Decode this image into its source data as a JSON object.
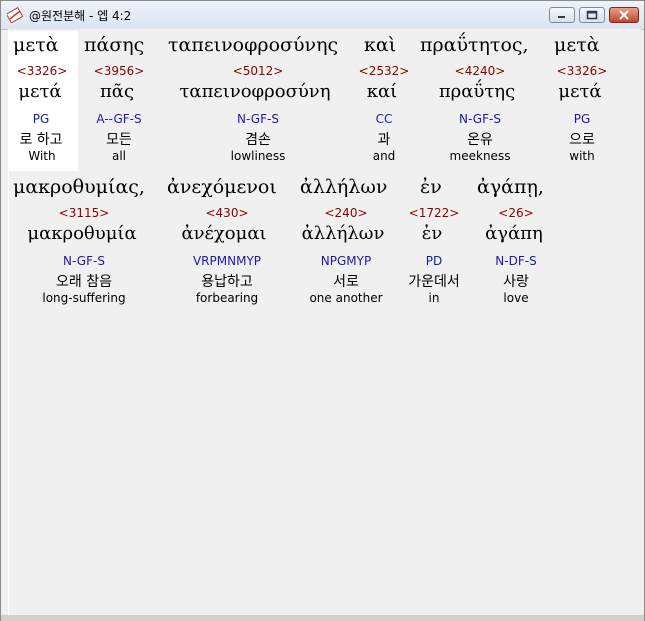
{
  "window": {
    "title": "@원전분해 - 엡 4:2",
    "minimize_icon": "minimize-icon",
    "maximize_icon": "maximize-icon",
    "close_icon": "close-icon"
  },
  "words": [
    {
      "greek": "μετὰ",
      "strong": "<3326>",
      "lemma": "μετά",
      "parse": "PG",
      "korean": "로 하고",
      "english": "With",
      "selected": true
    },
    {
      "greek": "πάσης",
      "strong": "<3956>",
      "lemma": "πᾶς",
      "parse": "A--GF-S",
      "korean": "모든",
      "english": "all"
    },
    {
      "greek": "ταπεινοφροσύνης",
      "strong": "<5012>",
      "lemma": "ταπεινοφροσύνη",
      "parse": "N-GF-S",
      "korean": "겸손",
      "english": "lowliness"
    },
    {
      "greek": "καὶ",
      "strong": "<2532>",
      "lemma": "καί",
      "parse": "CC",
      "korean": "과",
      "english": "and"
    },
    {
      "greek": "πραΰτητος,",
      "strong": "<4240>",
      "lemma": "πραΰτης",
      "parse": "N-GF-S",
      "korean": "온유",
      "english": "meekness"
    },
    {
      "greek": "μετὰ",
      "strong": "<3326>",
      "lemma": "μετά",
      "parse": "PG",
      "korean": "으로",
      "english": "with"
    },
    {
      "greek": "μακροθυμίας,",
      "strong": "<3115>",
      "lemma": "μακροθυμία",
      "parse": "N-GF-S",
      "korean": "오래 참음",
      "english": "long-suffering"
    },
    {
      "greek": "ἀνεχόμενοι",
      "strong": "<430>",
      "lemma": "ἀνέχομαι",
      "parse": "VRPMNMYP",
      "korean": "용납하고",
      "english": "forbearing"
    },
    {
      "greek": "ἀλλήλων",
      "strong": "<240>",
      "lemma": "ἀλλήλων",
      "parse": "NPGMYP",
      "korean": "서로",
      "english": "one another"
    },
    {
      "greek": "ἐν",
      "strong": "<1722>",
      "lemma": "ἐν",
      "parse": "PD",
      "korean": "가운데서",
      "english": "in"
    },
    {
      "greek": "ἀγάπῃ,",
      "strong": "<26>",
      "lemma": "ἀγάπη",
      "parse": "N-DF-S",
      "korean": "사랑",
      "english": "love"
    }
  ],
  "colors": {
    "strong_number": "#8b0000",
    "parsing_code": "#1a1aa8",
    "selected_background": "#ffffff",
    "content_background": "#f0f0f0"
  }
}
